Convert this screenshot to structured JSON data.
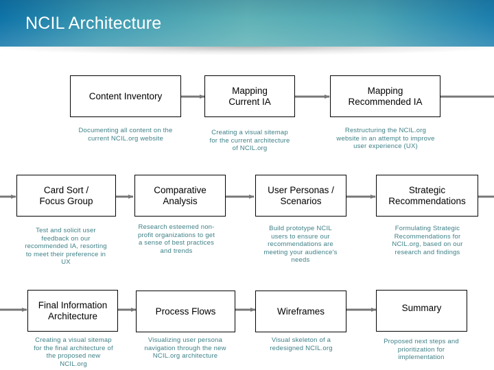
{
  "header": {
    "title": "NCIL Architecture"
  },
  "colors": {
    "arrow": "#777777",
    "description_text": "#3d7f86",
    "header_start": "#0f74a8",
    "header_mid": "#5fb2b6"
  },
  "steps": [
    {
      "title": "Content Inventory",
      "description": "Documenting all content on the\ncurrent NCIL.org website"
    },
    {
      "title": "Mapping\nCurrent IA",
      "description": "Creating a visual sitemap\nfor the current architecture\nof NCIL.org"
    },
    {
      "title": "Mapping\nRecommended IA",
      "description": "Restructuring the NCIL.org\nwebsite in an attempt to improve\nuser experience (UX)"
    },
    {
      "title": "Card Sort /\nFocus Group",
      "description": "Test and solicit user\nfeedback on our\nrecommended IA, resorting\nto meet their preference in\nUX"
    },
    {
      "title": "Comparative\nAnalysis",
      "description": "Research esteemed non-\nprofit organizations to get\na sense of best practices\nand trends"
    },
    {
      "title": "User Personas /\nScenarios",
      "description": "Build prototype NCIL\nusers to ensure our\nrecommendations are\nmeeting your audience's\nneeds"
    },
    {
      "title": "Strategic\nRecommendations",
      "description": "Formulating Strategic\nRecommendations for\nNCIL.org, based on our\nresearch and findings"
    },
    {
      "title": "Final Information\nArchitecture",
      "description": "Creating a visual sitemap\nfor the final architecture of\nthe proposed new\nNCIL.org"
    },
    {
      "title": "Process Flows",
      "description": "Visualizing user persona\nnavigation through the new\nNCIL.org architecture"
    },
    {
      "title": "Wireframes",
      "description": "Visual skeleton of a\nredesigned NCIL.org"
    },
    {
      "title": "Summary",
      "description": "Proposed next steps and\nprioritization for\nimplementation"
    }
  ]
}
